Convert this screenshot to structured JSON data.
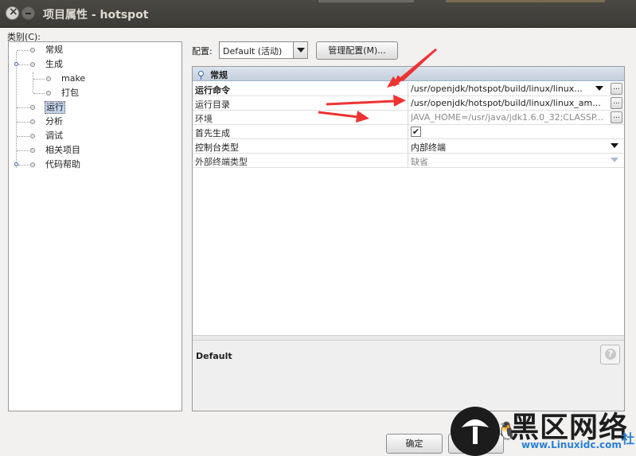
{
  "window": {
    "title": "项目属性 - hotspot"
  },
  "categories": {
    "label": "类别(C):",
    "items": [
      {
        "label": "常规"
      },
      {
        "label": "生成"
      },
      {
        "label": "make"
      },
      {
        "label": "打包"
      },
      {
        "label": "运行",
        "selected": true
      },
      {
        "label": "分析"
      },
      {
        "label": "调试"
      },
      {
        "label": "相关项目"
      },
      {
        "label": "代码帮助"
      }
    ]
  },
  "config": {
    "label": "配置:",
    "selected": "Default (活动)",
    "manage_button": "管理配置(M)..."
  },
  "properties": {
    "section": "常规",
    "rows": [
      {
        "name": "运行命令",
        "value": "/usr/openjdk/hotspot/build/linux/linux..."
      },
      {
        "name": "运行目录",
        "value": "/usr/openjdk/hotspot/build/linux/linux_am..."
      },
      {
        "name": "环境",
        "value": "JAVA_HOME=/usr/java/jdk1.6.0_32;CLASSP..."
      },
      {
        "name": "首先生成",
        "value": "✔"
      },
      {
        "name": "控制台类型",
        "value": "内部终端"
      },
      {
        "name": "外部终端类型",
        "value": "缺省"
      }
    ],
    "dots_label": "..."
  },
  "description": {
    "title": "Default"
  },
  "buttons": {
    "ok": "确定"
  },
  "watermark": {
    "text": "黑区网络",
    "url": "www.Linuxidc.com",
    "badge": "社"
  },
  "colors": {
    "arrow": "#ee3333",
    "selection": "#c4d4ea",
    "header": "#c3cfdd"
  }
}
